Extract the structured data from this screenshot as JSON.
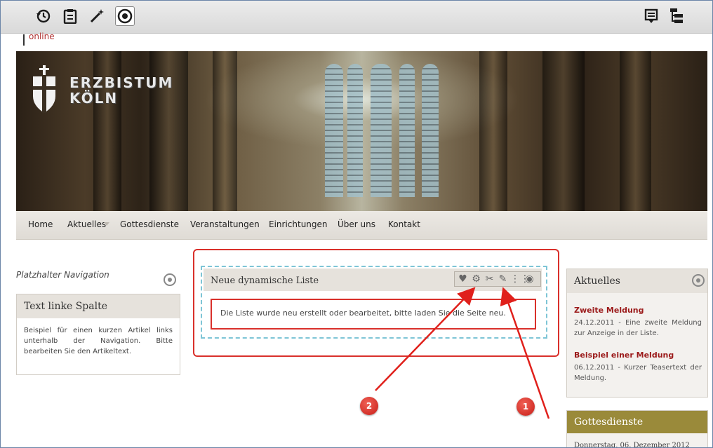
{
  "toolbar": {
    "left_icons": [
      "history-icon",
      "clipboard-icon",
      "magic-wand-icon",
      "target-icon"
    ],
    "right_icons": [
      "publish-list-icon",
      "sitemap-icon"
    ]
  },
  "header": {
    "logo_text": "online",
    "brand_line1": "ERZBISTUM",
    "brand_line2": "KÖLN"
  },
  "nav": {
    "items": [
      "Home",
      "Aktuelles",
      "Gottesdienste",
      "Veranstaltungen",
      "Einrichtungen",
      "Über uns",
      "Kontakt"
    ]
  },
  "left_column": {
    "placeholder": "Platzhalter Navigation",
    "box_title": "Text linke Spalte",
    "box_text": "Beispiel für einen kurzen Artikel links unterhalb der Navigation. Bitte bearbeiten Sie den Artikeltext."
  },
  "center": {
    "list_title": "Neue dynamische Liste",
    "message": "Die Liste wurde neu erstellt oder bearbeitet, bitte laden Sie die Seite neu.",
    "edit_icons": [
      "favorite-add-icon",
      "settings-gear-icon",
      "scissors-icon",
      "pencil-icon",
      "grid-icon",
      "target-icon"
    ]
  },
  "right_column": {
    "box1_title": "Aktuelles",
    "news": [
      {
        "title": "Zweite Meldung",
        "text": "24.12.2011 - Eine zweite Meldung zur Anzeige in der Liste."
      },
      {
        "title": "Beispiel einer Meldung",
        "text": "06.12.2011 - Kurzer Teasertext der Meldung."
      }
    ],
    "box2_title": "Gottesdienste",
    "box2_sub": "Donnerstag, 06. Dezember 2012"
  },
  "annotations": {
    "marker1": "1",
    "marker2": "2",
    "arrow_color": "#e0201b"
  }
}
